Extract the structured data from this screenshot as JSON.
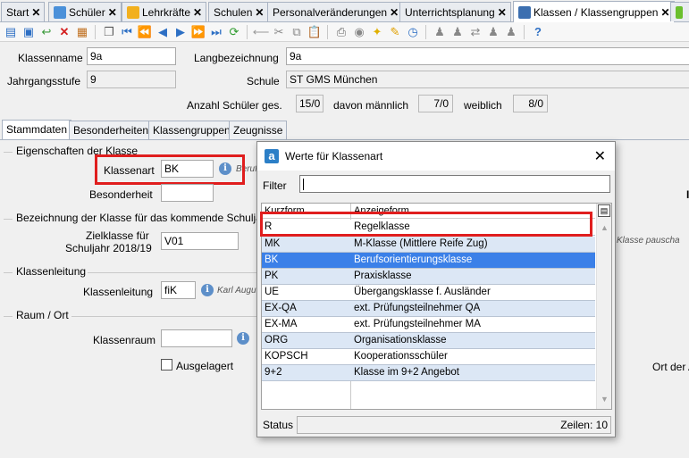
{
  "tabs": [
    {
      "label": "Start",
      "close": "✕"
    },
    {
      "label": "Schüler",
      "close": "✕"
    },
    {
      "label": "Lehrkräfte",
      "close": "✕"
    },
    {
      "label": "Schulen",
      "close": "✕"
    },
    {
      "label": "Personalveränderungen",
      "close": "✕"
    },
    {
      "label": "Unterrichtsplanung",
      "close": "✕"
    },
    {
      "label": "Klassen / Klassengruppen",
      "close": "✕"
    }
  ],
  "form": {
    "klassenname_label": "Klassenname",
    "klassenname_value": "9a",
    "langbezeichnung_label": "Langbezeichnung",
    "langbezeichnung_value": "9a",
    "jahrgangsstufe_label": "Jahrgangsstufe",
    "jahrgangsstufe_value": "9",
    "schule_label": "Schule",
    "schule_value": "ST GMS München",
    "anzahl_label": "Anzahl Schüler ges.",
    "anzahl_value": "15/0",
    "maennlich_label": "davon männlich",
    "maennlich_value": "7/0",
    "weiblich_label": "weiblich",
    "weiblich_value": "8/0"
  },
  "subtabs": [
    "Stammdaten",
    "Besonderheiten",
    "Klassengruppen",
    "Zeugnisse"
  ],
  "panel": {
    "eigenschaften_group": "Eigenschaften der Klasse",
    "klassenart_label": "Klassenart",
    "klassenart_value": "BK",
    "klassenart_hint": "Beruf",
    "besonderheit_label": "Besonderheit",
    "bezeichnung_group": "Bezeichnung der Klasse für das kommende Schuljahr",
    "zielklasse_label_1": "Zielklasse für",
    "zielklasse_label_2": "Schuljahr 2018/19",
    "zielklasse_value": "V01",
    "right_hint": "Klasse pauscha",
    "klassenleitung_group": "Klassenleitung",
    "klassenleitung_label": "Klassenleitung",
    "klassenleitung_value": "fiK",
    "klassenleitung_hint": "Karl Augu",
    "raum_group": "Raum / Ort",
    "klassenraum_label": "Klassenraum",
    "ausgelagert_label": "Ausgelagert",
    "ort_label": "Ort der A"
  },
  "dialog": {
    "title": "Werte für Klassenart",
    "filter_label": "Filter",
    "col_kurzform": "Kurzform",
    "col_anzeigeform": "Anzeigeform",
    "rows": [
      {
        "kurz": "R",
        "anzeige": "Regelklasse"
      },
      {
        "kurz": "MK",
        "anzeige": "M-Klasse (Mittlere Reife Zug)"
      },
      {
        "kurz": "BK",
        "anzeige": "Berufsorientierungsklasse"
      },
      {
        "kurz": "PK",
        "anzeige": "Praxisklasse"
      },
      {
        "kurz": "UE",
        "anzeige": "Übergangsklasse f. Ausländer"
      },
      {
        "kurz": "EX-QA",
        "anzeige": "ext. Prüfungsteilnehmer QA"
      },
      {
        "kurz": "EX-MA",
        "anzeige": "ext. Prüfungsteilnehmer MA"
      },
      {
        "kurz": "ORG",
        "anzeige": "Organisationsklasse"
      },
      {
        "kurz": "KOPSCH",
        "anzeige": "Kooperationsschüler"
      },
      {
        "kurz": "9+2",
        "anzeige": "Klasse im 9+2 Angebot"
      }
    ],
    "status_label": "Status",
    "zeilen_label": "Zeilen: 10"
  },
  "colors": {
    "selected_row": "#3b80e8",
    "alt_row": "#dce7f5",
    "highlight_box": "#e01e1e"
  }
}
